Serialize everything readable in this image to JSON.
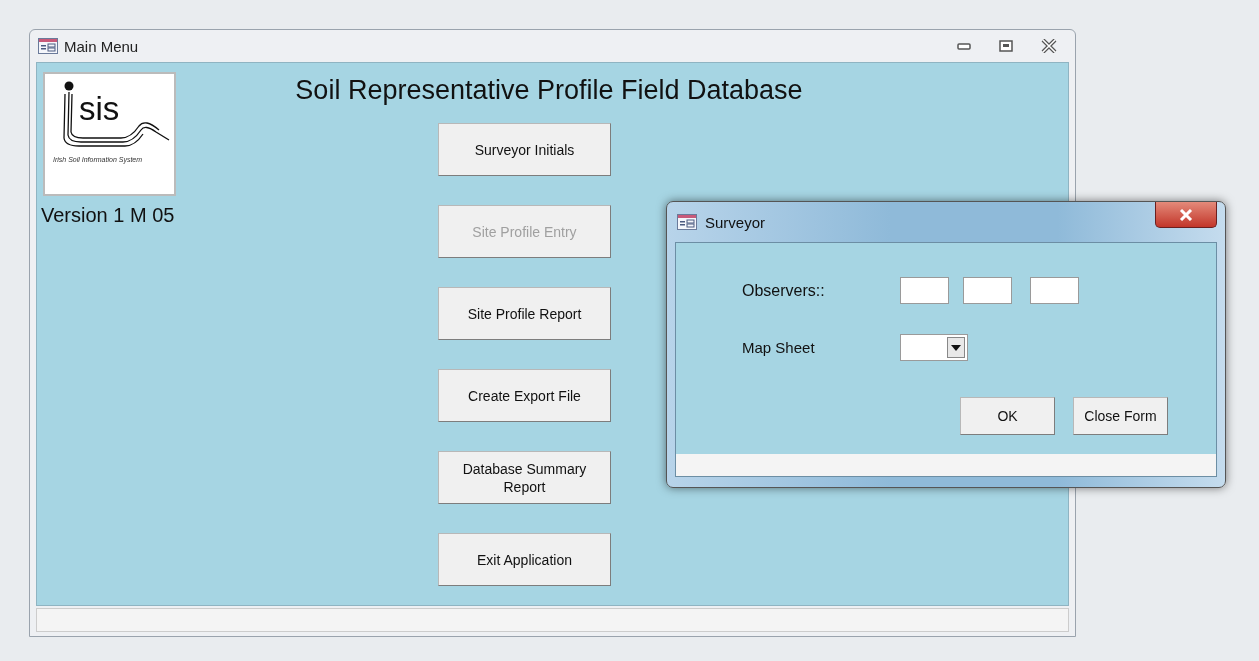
{
  "window": {
    "title": "Main Menu"
  },
  "logo": {
    "wordmark": "sis",
    "caption": "Irish Soil Information System"
  },
  "version": "Version 1 M 05",
  "heading": "Soil Representative Profile Field Database",
  "menu_buttons": [
    {
      "label": "Surveyor Initials",
      "disabled": false
    },
    {
      "label": "Site Profile Entry",
      "disabled": true
    },
    {
      "label": "Site Profile Report",
      "disabled": false
    },
    {
      "label": "Create Export File",
      "disabled": false
    },
    {
      "label": "Database Summary Report",
      "disabled": false
    },
    {
      "label": "Exit Application",
      "disabled": false
    }
  ],
  "dialog": {
    "title": "Surveyor",
    "observers_label": "Observers::",
    "map_sheet_label": "Map Sheet",
    "buttons": [
      "OK",
      "Close Form"
    ]
  }
}
